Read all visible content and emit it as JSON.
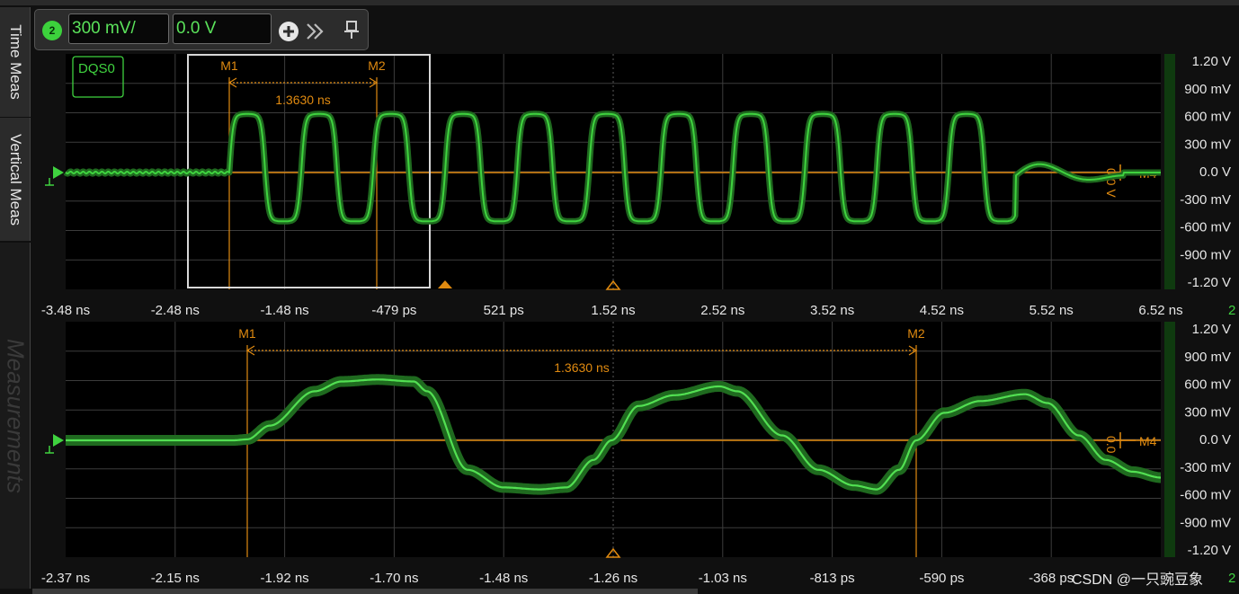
{
  "side_tabs": {
    "time_meas": "Time Meas",
    "vertical_meas": "Vertical Meas",
    "measurements": "Measurements"
  },
  "toolbar": {
    "channel_number": "2",
    "scale_value": "300 mV/",
    "offset_value": "0.0 V",
    "add_icon": "plus-circle-icon",
    "expand_icon": "double-chevron-right-icon",
    "pin_icon": "pin-icon"
  },
  "colors": {
    "trace": "#3fd23f",
    "trace_dark": "#1f6a1f",
    "marker": "#e08a10",
    "grid": "#3c3c3c",
    "scale_bg": "#0f3a0f"
  },
  "main_plot": {
    "channel_label": "DQS0",
    "x_tick_labels": [
      "-3.48 ns",
      "-2.48 ns",
      "-1.48 ns",
      "-479 ps",
      "521 ps",
      "1.52 ns",
      "2.52 ns",
      "3.52 ns",
      "4.52 ns",
      "5.52 ns",
      "6.52 ns"
    ],
    "y_tick_labels": [
      "1.20 V",
      "900 mV",
      "600 mV",
      "300 mV",
      "0.0 V",
      "-300 mV",
      "-600 mV",
      "-900 mV",
      "-1.20 V"
    ],
    "marker_1": "M1",
    "marker_2": "M2",
    "delta_label": "1.3630 ns",
    "level_label": "0.0 V",
    "level_marker": "M4",
    "corner_label": "2"
  },
  "zoom_plot": {
    "x_tick_labels": [
      "-2.37 ns",
      "-2.15 ns",
      "-1.92 ns",
      "-1.70 ns",
      "-1.48 ns",
      "-1.26 ns",
      "-1.03 ns",
      "-813 ps",
      "-590 ps",
      "-368 ps"
    ],
    "y_tick_labels": [
      "1.20 V",
      "900 mV",
      "600 mV",
      "300 mV",
      "0.0 V",
      "-300 mV",
      "-600 mV",
      "-900 mV",
      "-1.20 V"
    ],
    "marker_1": "M1",
    "marker_2": "M2",
    "delta_label": "1.3630 ns",
    "level_label": "0.0 V",
    "level_marker": "M4",
    "corner_label": "2"
  },
  "watermark": "CSDN @一只豌豆象"
}
